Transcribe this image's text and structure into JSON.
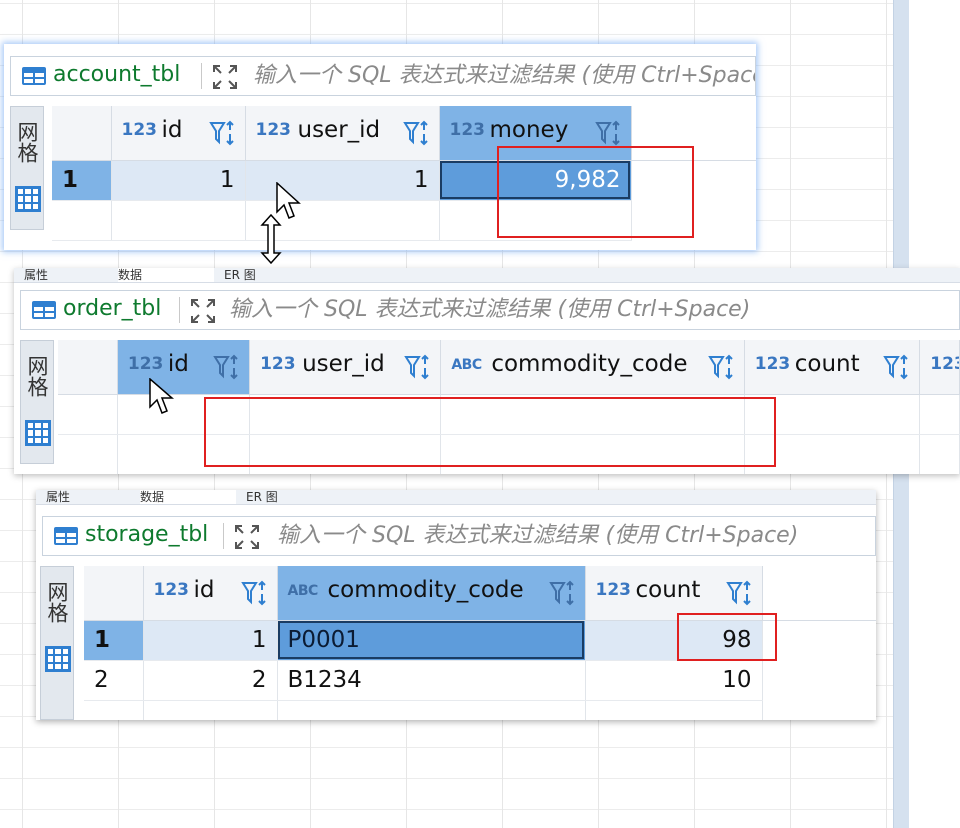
{
  "sidebar_label": "网格",
  "filter_placeholder": "输入一个 SQL 表达式来过滤结果 (使用 Ctrl+Space)",
  "type_int": "123",
  "type_str": "ABC",
  "tabs": {
    "properties": "属性",
    "data": "数据",
    "er": "ER 图"
  },
  "account": {
    "table_name": "account_tbl",
    "columns": [
      "id",
      "user_id",
      "money"
    ],
    "rows": [
      {
        "row": "1",
        "cells": [
          "1",
          "1",
          "9,982"
        ]
      }
    ]
  },
  "order": {
    "table_name": "order_tbl",
    "columns": [
      "id",
      "user_id",
      "commodity_code",
      "count"
    ],
    "rows": []
  },
  "storage": {
    "table_name": "storage_tbl",
    "columns": [
      "id",
      "commodity_code",
      "count"
    ],
    "rows": [
      {
        "row": "1",
        "cells": [
          "1",
          "P0001",
          "98"
        ]
      },
      {
        "row": "2",
        "cells": [
          "2",
          "B1234",
          "10"
        ]
      }
    ]
  },
  "colors": {
    "table_name": "#0e7a2e",
    "selection": "#5e9cdb",
    "highlight_box": "#e02020"
  }
}
